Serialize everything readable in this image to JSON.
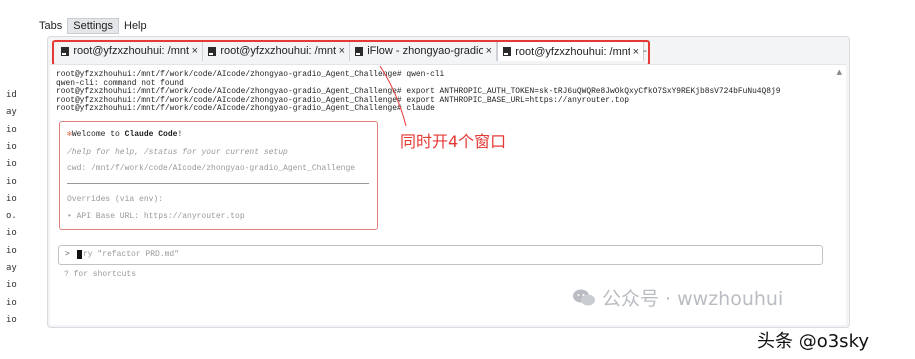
{
  "menubar": {
    "items": [
      "Tabs",
      "Settings",
      "Help"
    ]
  },
  "left_labels": [
    "id",
    "ay",
    "io",
    "io",
    "io",
    "io",
    "io",
    "o.",
    "io",
    "io",
    "ay",
    "io",
    "io",
    "io"
  ],
  "tabs": [
    {
      "label": "root@yfzxzhouhui: /mnt/f,",
      "close": "×"
    },
    {
      "label": "root@yfzxzhouhui: /mnt/f,",
      "close": "×"
    },
    {
      "label": "iFlow - zhongyao-gradio_/",
      "close": "×"
    },
    {
      "label": "root@yfzxzhouhui: /mnt/f,",
      "close": "×"
    }
  ],
  "tab_overflow": "-",
  "terminal_lines": [
    "root@yfzxzhouhui:/mnt/f/work/code/AIcode/zhongyao-gradio_Agent_Challenge# qwen-cli",
    "qwen-cli: command not found",
    "root@yfzxzhouhui:/mnt/f/work/code/AIcode/zhongyao-gradio_Agent_Challenge# export ANTHROPIC_AUTH_TOKEN=sk-tRJ6uQWQRe8JwOkQxyCfkO7SxY9REKjb8sV724bFuNu4Q8j9",
    "root@yfzxzhouhui:/mnt/f/work/code/AIcode/zhongyao-gradio_Agent_Challenge# export ANTHROPIC_BASE_URL=https://anyrouter.top",
    "root@yfzxzhouhui:/mnt/f/work/code/AIcode/zhongyao-gradio_Agent_Challenge# claude"
  ],
  "welcome": {
    "star": "✻",
    "prefix": "Welcome to ",
    "app": "Claude Code",
    "suffix": "!",
    "help": "/help for help, /status for your current setup",
    "cwd": "cwd: /mnt/f/work/code/AIcode/zhongyao-gradio_Agent_Challenge",
    "overrides": "Overrides (via env):",
    "api_base": "• API Base URL: https://anyrouter.top"
  },
  "annotation": "同时开4个窗口",
  "prompt": {
    "chevron": ">",
    "placeholder": "ry \"refactor PRD.md\""
  },
  "hint": "? for shortcuts",
  "watermark": {
    "text": "公众号 · wwzhouhui",
    "icon": "wechat-icon"
  },
  "credit": "头条 @o3sky",
  "colors": {
    "highlight": "#e53935",
    "box_border": "#e0807a",
    "star": "#e07a5f"
  }
}
